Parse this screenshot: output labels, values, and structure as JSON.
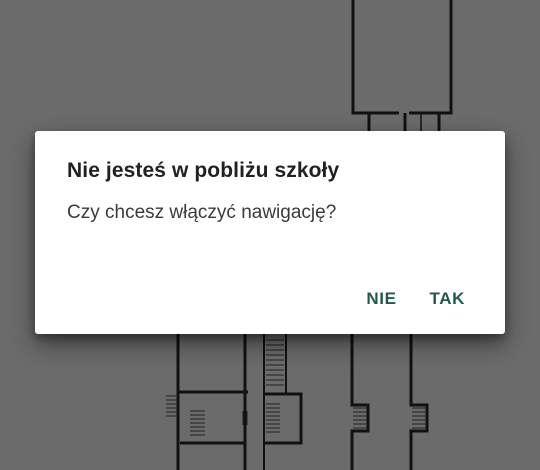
{
  "map": {
    "background_color": "#6b6b6b",
    "line_color": "#111111"
  },
  "dialog": {
    "title": "Nie jesteś w pobliżu szkoły",
    "message": "Czy chcesz włączyć nawigację?",
    "buttons": {
      "negative_label": "NIE",
      "positive_label": "TAK"
    },
    "accent_color": "#1f5b4c"
  }
}
